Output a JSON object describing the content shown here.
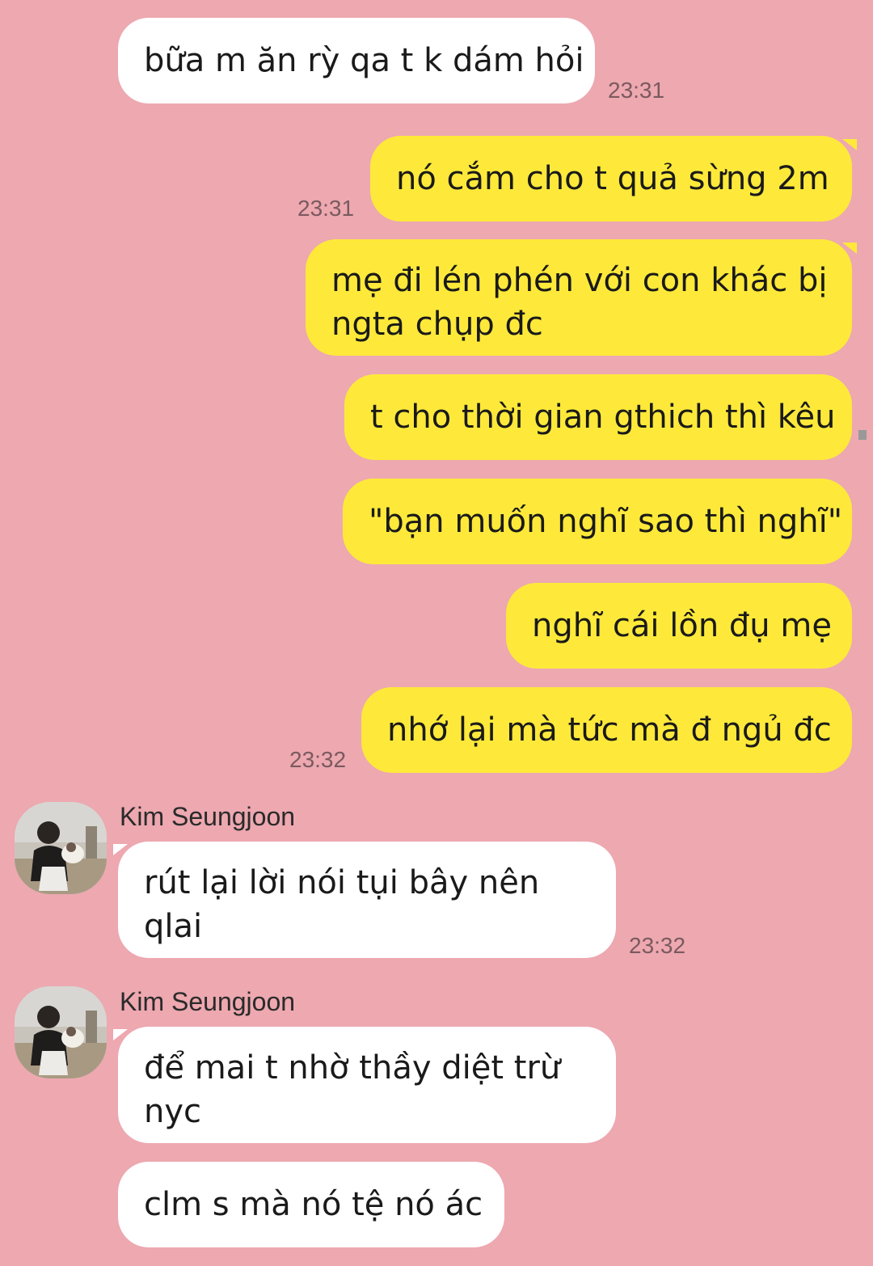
{
  "messages": [
    {
      "text": "bữa m ăn rỳ qa t k dám hỏi",
      "time": "23:31"
    },
    {
      "text": "nó cắm cho t quả sừng 2m",
      "time": "23:31"
    },
    {
      "text": "mẹ đi lén phén với con khác bị ngta chụp đc"
    },
    {
      "text": "t cho thời gian gthich thì kêu"
    },
    {
      "text": "\"bạn muốn nghĩ sao thì nghĩ\""
    },
    {
      "text": "nghĩ cái lồn đụ mẹ"
    },
    {
      "text": "nhớ lại mà tức mà đ ngủ đc",
      "time": "23:32"
    },
    {
      "sender": "Kim Seungjoon",
      "text": "rút lại lời nói tụi bây nên qlai",
      "time": "23:32"
    },
    {
      "sender": "Kim Seungjoon",
      "text": "để mai t nhờ thầy diệt trừ nyc"
    },
    {
      "text": "clm s mà nó tệ nó ác"
    }
  ],
  "colors": {
    "background": "#EDA8B0",
    "outgoing_bubble": "#FEE93A",
    "incoming_bubble": "#FFFFFF"
  },
  "icons": {
    "avatar": "profile-photo"
  }
}
